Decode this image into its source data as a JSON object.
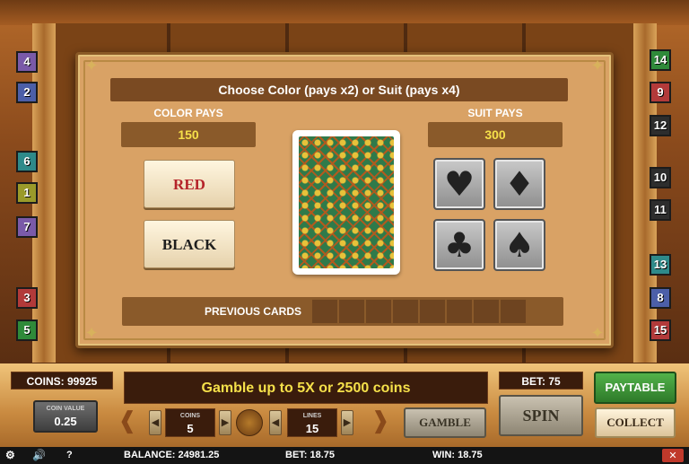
{
  "dialog": {
    "title": "Choose Color (pays x2) or Suit (pays x4)",
    "color_pays_label": "COLOR PAYS",
    "color_pays_value": "150",
    "suit_pays_label": "SUIT PAYS",
    "suit_pays_value": "300",
    "red_label": "RED",
    "black_label": "BLACK",
    "suits": [
      "♥",
      "♦",
      "♣",
      "♠"
    ],
    "suit_icons": [
      "heart-icon",
      "diamond-icon",
      "club-icon",
      "spade-icon"
    ],
    "previous_cards_label": "PREVIOUS CARDS"
  },
  "line_badges": {
    "left": [
      "4",
      "2",
      "6",
      "1",
      "7",
      "3",
      "5"
    ],
    "right": [
      "14",
      "9",
      "12",
      "10",
      "11",
      "13",
      "8",
      "15"
    ]
  },
  "panel": {
    "coins_display": "COINS: 99925",
    "message": "Gamble up to 5X or 2500 coins",
    "bet_display": "BET: 75",
    "paytable_label": "PAYTABLE",
    "coin_value_label": "COIN VALUE",
    "coin_value": "0.25",
    "coins_label": "COINS",
    "coins_value": "5",
    "lines_label": "LINES",
    "lines_value": "15",
    "gamble_label": "GAMBLE",
    "spin_label": "SPIN",
    "collect_label": "COLLECT"
  },
  "status": {
    "balance": "BALANCE: 24981.25",
    "bet": "BET: 18.75",
    "win": "WIN: 18.75",
    "help": "?",
    "close": "✕"
  },
  "colors": {
    "accent_yellow": "#f5e04a",
    "red_text": "#b5242a",
    "paytable_green": "#2e7a2a"
  }
}
